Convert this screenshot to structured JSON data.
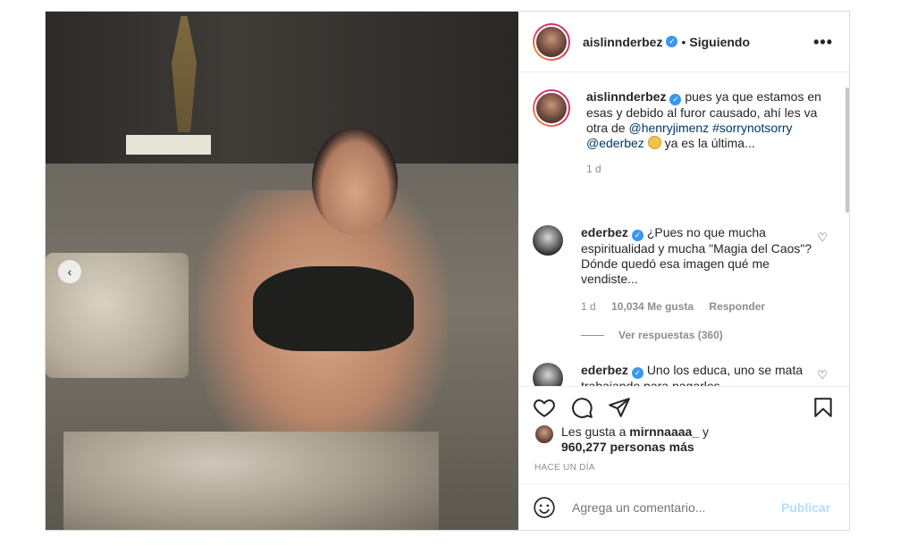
{
  "header": {
    "username": "aislinnderbez",
    "separator": "•",
    "follow_status": "Siguiendo",
    "more_label": "•••"
  },
  "caption": {
    "username": "aislinnderbez",
    "text_before": "pues ya que estamos en esas y debido al furor causado, ahí les va otra de",
    "mention1": "@henryjimenz",
    "hashtag": "#sorrynotsorry",
    "mention2": "@ederbez",
    "text_after": "ya es la última...",
    "age": "1 d"
  },
  "comments": [
    {
      "username": "ederbez",
      "text": "¿Pues no que mucha espiritualidad y mucha \"Magia del Caos\"? Dónde quedó esa imagen qué me vendiste...",
      "age": "1 d",
      "likes": "10,034 Me gusta",
      "reply": "Responder",
      "view_replies": "Ver respuestas (360)"
    },
    {
      "username": "ederbez",
      "text": "Uno los educa, uno se mata trabajando para pagarles"
    }
  ],
  "likes": {
    "prefix": "Les gusta a",
    "user": "mirnnaaaa_",
    "conj": "y",
    "others": "960,277 personas más"
  },
  "timestamp": "HACE UN DÍA",
  "comment_box": {
    "placeholder": "Agrega un comentario...",
    "publish": "Publicar"
  },
  "icons": {
    "prev": "‹",
    "heart": "♡",
    "verified": "✓"
  },
  "colors": {
    "link": "#00376b",
    "verified": "#3897f0",
    "publish_disabled": "#b2dffc"
  }
}
